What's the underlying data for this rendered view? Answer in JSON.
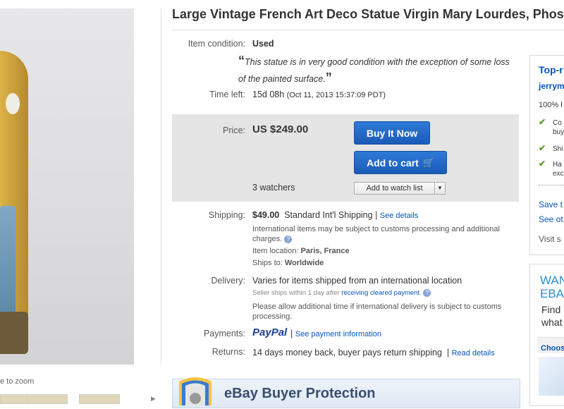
{
  "gallery": {
    "zoom_hint": "e to zoom"
  },
  "listing": {
    "title": "Large Vintage French Art Deco Statue Virgin Mary Lourdes, Phosp"
  },
  "details": {
    "condition_label": "Item condition:",
    "condition_value": "Used",
    "condition_note_open": "“",
    "condition_note": "This statue is in very good condition with the exception of some loss of the painted surface.",
    "condition_note_close": "”",
    "time_left_label": "Time left:",
    "time_left_value": "15d 08h",
    "time_left_end": "(Oct 11, 2013  15:37:09 PDT)"
  },
  "buy_box": {
    "price_label": "Price:",
    "price_value": "US $249.00",
    "buy_it_now": "Buy It Now",
    "add_to_cart": "Add to cart",
    "watchers": "3 watchers",
    "watch_list": "Add to watch list"
  },
  "shipping": {
    "label": "Shipping:",
    "cost": "$49.00",
    "service": "Standard Int'l Shipping",
    "separator": "|",
    "see_details": "See details",
    "customs_note": "International items may be subject to customs processing and additional charges.",
    "location_label": "Item location:",
    "location_value": "Paris, France",
    "ships_to_label": "Ships to:",
    "ships_to_value": "Worldwide"
  },
  "delivery": {
    "label": "Delivery:",
    "value": "Varies for items shipped from an international location",
    "handling_prefix": "Seller ships within 1 day after",
    "handling_link": "receiving cleared payment",
    "handling_suffix": ".",
    "note": "Please allow additional time if international delivery is subject to customs processing."
  },
  "payments": {
    "label": "Payments:",
    "paypal": "PayPal",
    "separator": "|",
    "see_info": "See payment information"
  },
  "returns": {
    "label": "Returns:",
    "value": "14 days money back, buyer pays return shipping",
    "separator": "|",
    "read_details": "Read details"
  },
  "protection": {
    "title": "eBay Buyer Protection"
  },
  "seller_panel": {
    "heading": "Top-r",
    "seller_name": "jerrym",
    "feedback": "100% l",
    "checks": [
      "Co",
      "buy",
      "Shi",
      "Ha",
      "exc"
    ],
    "save_link": "Save t",
    "see_other": "See ot",
    "visit": "Visit s"
  },
  "ad_panel": {
    "ad_line1": "WAN",
    "ad_line2": "EBA",
    "ad_line3": "Find",
    "ad_line4": "what",
    "choose": "Choos"
  },
  "colors": {
    "accent_blue": "#0654ba",
    "button_blue": "#1b5bb8",
    "check_green": "#5a9e2c",
    "buybox_gray": "#e5e5e5"
  }
}
